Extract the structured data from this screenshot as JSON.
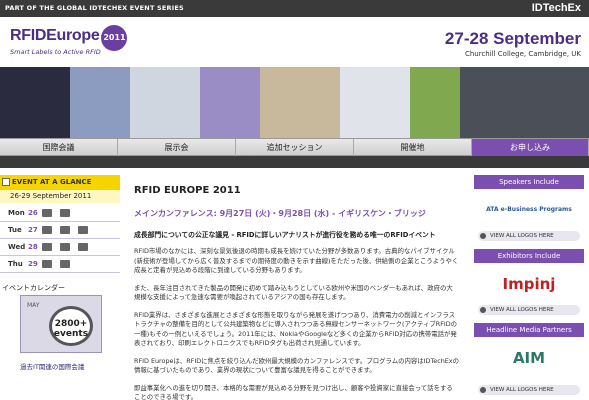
{
  "topbar": {
    "tagline": "PART OF THE GLOBAL IDTECHEX EVENT SERIES",
    "brand": "IDTechEx"
  },
  "logo": {
    "title": "RFIDEurope",
    "year": "2011",
    "subtitle": "Smart Labels to Active RFID"
  },
  "event": {
    "dates": "27-28 September",
    "venue": "Churchill College, Cambridge, UK"
  },
  "nav": {
    "items": [
      "国際会議",
      "展示会",
      "追加セッション",
      "開催地",
      "お申し込み"
    ]
  },
  "sidebar": {
    "glance_title": "EVENT AT A GLANCE",
    "glance_date": "26-29 September 2011",
    "days": [
      {
        "name": "Mon",
        "date": "26"
      },
      {
        "name": "Tue",
        "date": "27"
      },
      {
        "name": "Wed",
        "date": "28"
      },
      {
        "name": "Thu",
        "date": "29"
      }
    ],
    "calendar_title": "イベントカレンダー",
    "calendar_month": "MAY",
    "calendar_badge": "2800+ events",
    "calendar_link": "過去IT関連の国際会議"
  },
  "main": {
    "title": "RFID EUROPE 2011",
    "subtitle": "メインカンファレンス: 9月27日 (火)・9月28日 (水) - イギリスケン・ブリッジ",
    "lead": "成長部門についての公正な議見 - RFIDに詳しいアナリストが進行役を務める唯一のRFIDイベント",
    "paragraphs": [
      "RFID市場のなかには、深刻な景気後退の時期も成長を続けていた分野が多数あります。古典的なパイブサイクル(新技術が登場してから広く普及するまでの期待度の動きを示す曲線)をただった後、供給側の企業とこうようやく成長と定着が見込める段階に到達している分野もあります。",
      "また、長年注目されてきた製品の開発に初めて踏み込もうとしている欧州や米国のベンダーもあれば、政府の大規模な支援によって急速な需要が喚起されているアジアの国も存在します。",
      "RFID業界は、さまざまな進展とさまざまな形態を取りながら発展を遂げつつあり、消費電力の削減とインフラストラクチャの整備を目的として公共建築物などに導入されつつある無線センサーネットワーク(アクティブRFIDの一種)もその一例といえるでしょう。2011年には、NokiaやGoogleなど多くの企業からRFID対応の携帯電話が発表されており、印刷エレクトロニクスでもRFIDタグも出荷され見通しています。",
      "RFID Europeは、RFIDに焦点を絞り込んだ欧州最大規模のカンファレンスです。プログラムの内容はIDTechExの情報に基づいたものであり、業界の現状について豊富な議見を得ることができます。",
      "即益事業化への進を切り開き、本格的な需要が見込める分野を見つけ出し、顧客や投資家に直接会って話をすることのできる場です。"
    ]
  },
  "right": {
    "speakers_head": "Speakers Include",
    "speakers_logo": "ATA e-Business Programs",
    "exhibitors_head": "Exhibitors Include",
    "exhibitors_logo": "Impinj",
    "media_head": "Headline Media Partners",
    "media_logo": "AIM",
    "view_all": "VIEW ALL LOGOS HERE"
  },
  "colors": {
    "accent": "#7b4fb0",
    "brand_dark": "#4b2e83",
    "glance_yellow": "#f5d400"
  }
}
